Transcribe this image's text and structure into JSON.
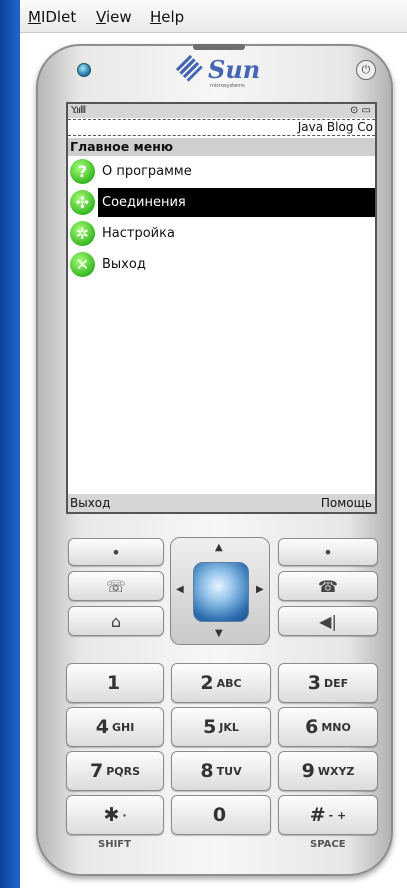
{
  "menubar": {
    "items": [
      "MIDlet",
      "View",
      "Help"
    ]
  },
  "device": {
    "brand": "Sun",
    "brand_sub": "microsystems",
    "power_icon": "power-icon"
  },
  "screen": {
    "status": {
      "signal": "Y.ıılll",
      "indicators": "⊙ ▭"
    },
    "ticker": "Java Blog Co",
    "title": "Главное меню",
    "items": [
      {
        "label": "О программе",
        "icon": "question-icon",
        "glyph": "?",
        "selected": false
      },
      {
        "label": "Соединения",
        "icon": "connection-icon",
        "glyph": "✣",
        "selected": true
      },
      {
        "label": "Настройка",
        "icon": "gear-icon",
        "glyph": "✲",
        "selected": false
      },
      {
        "label": "Выход",
        "icon": "exit-icon",
        "glyph": "✕",
        "selected": false
      }
    ],
    "softkeys": {
      "left": "Выход",
      "right": "Помощь"
    }
  },
  "keypad": {
    "soft_left": "•",
    "soft_right": "•",
    "call": "☏",
    "end": "☎",
    "home": "⌂",
    "clear": "◀|",
    "keys": [
      {
        "digit": "1",
        "letters": ""
      },
      {
        "digit": "2",
        "letters": "ABC"
      },
      {
        "digit": "3",
        "letters": "DEF"
      },
      {
        "digit": "4",
        "letters": "GHI"
      },
      {
        "digit": "5",
        "letters": "JKL"
      },
      {
        "digit": "6",
        "letters": "MNO"
      },
      {
        "digit": "7",
        "letters": "PQRS"
      },
      {
        "digit": "8",
        "letters": "TUV"
      },
      {
        "digit": "9",
        "letters": "WXYZ"
      },
      {
        "digit": "✱",
        "letters": "·"
      },
      {
        "digit": "0",
        "letters": ""
      },
      {
        "digit": "#",
        "letters": "- +"
      }
    ],
    "shift_label": "SHIFT",
    "space_label": "SPACE"
  }
}
